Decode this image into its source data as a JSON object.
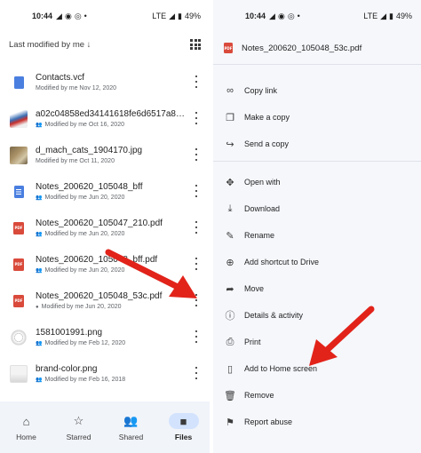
{
  "left_screen": {
    "status": {
      "time": "10:44",
      "network": "LTE",
      "battery": "49%"
    },
    "sort": {
      "label": "Last modified by me",
      "arrow": "↓"
    },
    "files": [
      {
        "name": "Contacts.vcf",
        "meta": "Modified by me Nov 12, 2020",
        "thumb": "vcf",
        "shared": false
      },
      {
        "name": "a02c04858ed34141618fe6d6517a8a...",
        "meta": "Modified by me Oct 16, 2020",
        "thumb": "sneaker",
        "shared": true
      },
      {
        "name": "d_mach_cats_1904170.jpg",
        "meta": "Modified by me Oct 11, 2020",
        "thumb": "cats",
        "shared": false
      },
      {
        "name": "Notes_200620_105048_bff",
        "meta": "Modified by me Jun 20, 2020",
        "thumb": "gdoc",
        "shared": true
      },
      {
        "name": "Notes_200620_105047_210.pdf",
        "meta": "Modified by me Jun 20, 2020",
        "thumb": "pdf",
        "shared": true
      },
      {
        "name": "Notes_200620_105048_bff.pdf",
        "meta": "Modified by me Jun 20, 2020",
        "thumb": "pdf",
        "shared": true
      },
      {
        "name": "Notes_200620_105048_53c.pdf",
        "meta": "Modified by me Jun 20, 2020",
        "thumb": "pdf",
        "shared": false,
        "offline": true
      },
      {
        "name": "1581001991.png",
        "meta": "Modified by me Feb 12, 2020",
        "thumb": "clock",
        "shared": true
      },
      {
        "name": "brand-color.png",
        "meta": "Modified by me Feb 16, 2018",
        "thumb": "brand",
        "shared": true
      }
    ],
    "nav": [
      {
        "label": "Home",
        "icon": "home-icon",
        "active": false
      },
      {
        "label": "Starred",
        "icon": "star-icon",
        "active": false
      },
      {
        "label": "Shared",
        "icon": "people-icon",
        "active": false
      },
      {
        "label": "Files",
        "icon": "folder-icon",
        "active": true
      }
    ]
  },
  "right_screen": {
    "status": {
      "time": "10:44",
      "network": "LTE",
      "battery": "49%"
    },
    "sheet_title": "Notes_200620_105048_53c.pdf",
    "menu_groups": [
      [
        {
          "label": "Copy link",
          "icon": "link-icon"
        },
        {
          "label": "Make a copy",
          "icon": "copy-icon"
        },
        {
          "label": "Send a copy",
          "icon": "send-icon"
        }
      ],
      [
        {
          "label": "Open with",
          "icon": "open-with-icon"
        },
        {
          "label": "Download",
          "icon": "download-icon"
        },
        {
          "label": "Rename",
          "icon": "rename-icon"
        },
        {
          "label": "Add shortcut to Drive",
          "icon": "shortcut-icon"
        },
        {
          "label": "Move",
          "icon": "move-icon"
        },
        {
          "label": "Details & activity",
          "icon": "info-icon"
        },
        {
          "label": "Print",
          "icon": "print-icon"
        },
        {
          "label": "Add to Home screen",
          "icon": "home-screen-icon"
        },
        {
          "label": "Remove",
          "icon": "trash-icon"
        },
        {
          "label": "Report abuse",
          "icon": "report-icon"
        }
      ]
    ]
  },
  "colors": {
    "arrow": "#e2231a",
    "pdf": "#d94a3b",
    "doc": "#4a7fe0",
    "nav_bg": "#f1f4f9",
    "nav_active_pill": "#d3e3fd",
    "sheet_bg": "#f5f7fb"
  }
}
